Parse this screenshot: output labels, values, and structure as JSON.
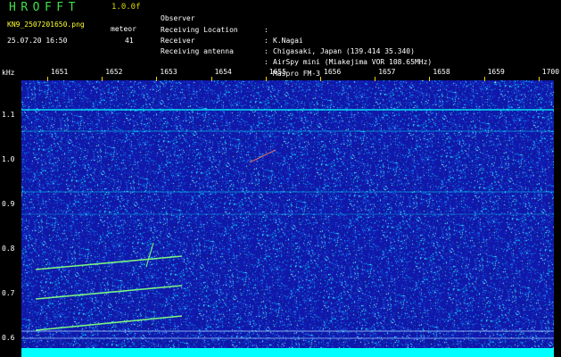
{
  "header": {
    "app_title": "HROFFT",
    "version": "1.0.0f",
    "file_name": "KN9_2507201650.png",
    "timestamp": "25.07.20 16:50",
    "mode_label": "meteor",
    "mode_value": "41"
  },
  "info": [
    {
      "label": "Observer",
      "sep": ":",
      "value": "K.Nagai"
    },
    {
      "label": "Receiving Location",
      "sep": ":",
      "value": "Chigasaki, Japan (139.414 35.340)"
    },
    {
      "label": "Receiver",
      "sep": ":",
      "value": "AirSpy mini (Miakejima VOR 108.65MHz)"
    },
    {
      "label": "Receiving antenna",
      "sep": ":",
      "value": "Maspro FM-3"
    }
  ],
  "axis": {
    "unit": "kHz",
    "time_ticks": [
      "1651",
      "1652",
      "1653",
      "1654",
      "1655",
      "1656",
      "1657",
      "1658",
      "1659",
      "1700"
    ],
    "freq_ticks": [
      "1.1",
      "1.0",
      "0.9",
      "0.8",
      "0.7",
      "0.6"
    ]
  },
  "colors": {
    "background": "#000000",
    "spectrogram_base": "#1a26a8",
    "noise_speck": "#00e0ff",
    "carrier_cyan": "#00ffff",
    "meteor_trail": "#80ff80",
    "title_green": "#3fe04a",
    "version_yellow": "#d8d800"
  }
}
